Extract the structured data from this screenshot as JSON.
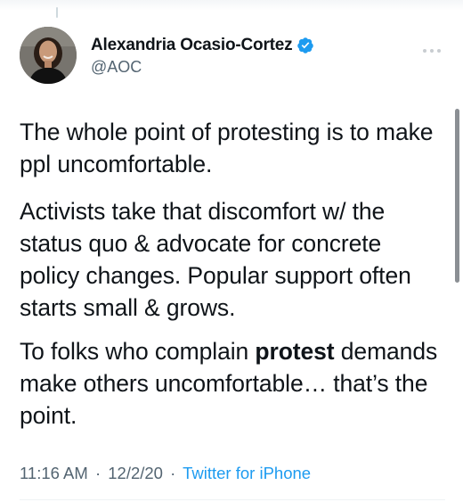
{
  "author": {
    "display_name": "Alexandria Ocasio-Cortez",
    "handle": "@AOC",
    "verified": true,
    "avatar_icon": "profile-photo"
  },
  "tweet": {
    "p1": "The whole point of protesting is to make ppl uncomfortable.",
    "p2": "Activists take that discomfort w/ the status quo & advocate for concrete policy changes. Popular support often starts small & grows.",
    "p3_before": "To folks who complain ",
    "p3_bold": "protest",
    "p3_after": " demands make others uncomfortable… that’s the point."
  },
  "meta": {
    "time": "11:16 AM",
    "separator": "·",
    "date": "12/2/20",
    "source": "Twitter for iPhone"
  },
  "icons": {
    "verified": "verified-badge-icon",
    "more": "more-options-icon"
  },
  "colors": {
    "text": "#0f1419",
    "secondary": "#536471",
    "accent": "#1d9bf0"
  }
}
